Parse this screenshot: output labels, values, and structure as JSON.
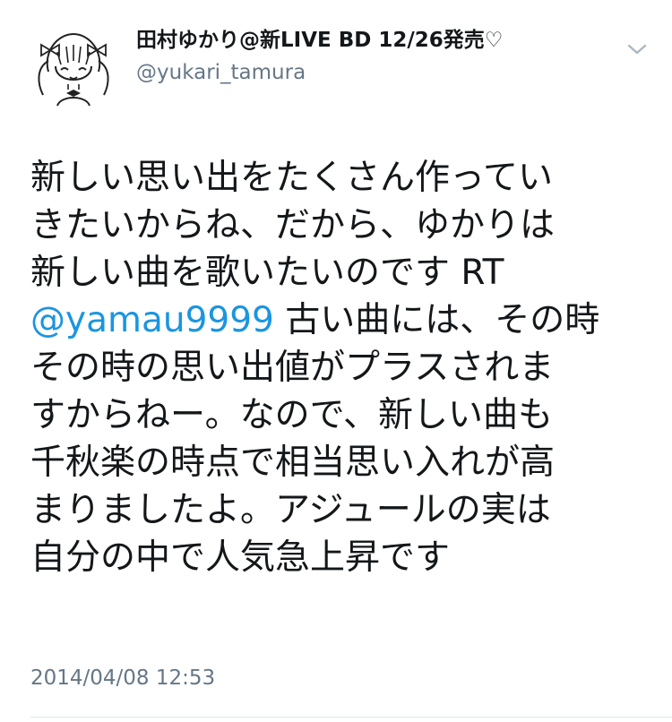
{
  "user": {
    "display_name": "田村ゆかり@新LIVE BD 12/26発売♡",
    "handle": "@yukari_tamura",
    "avatar_icon": "anime-girl-sketch-avatar"
  },
  "menu": {
    "icon": "chevron-down-icon"
  },
  "tweet": {
    "lines": [
      {
        "text": "新しい思い出をたくさん作ってい"
      },
      {
        "text": "きたいからね、だから、ゆかりは"
      },
      {
        "text": "新しい曲を歌いたいのです RT"
      },
      {
        "mention": "@yamau9999",
        "text": " 古い曲には、その時"
      },
      {
        "text": "その時の思い出値がプラスされま"
      },
      {
        "text": "すからねー。なので、新しい曲も"
      },
      {
        "text": "千秋楽の時点で相当思い入れが高"
      },
      {
        "text": "まりましたよ。アジュールの実は"
      },
      {
        "text": "自分の中で人気急上昇です"
      }
    ],
    "timestamp": "2014/04/08 12:53"
  },
  "colors": {
    "text": "#14171a",
    "secondary": "#657786",
    "link": "#1b95e0",
    "divider": "#e1e8ed"
  }
}
